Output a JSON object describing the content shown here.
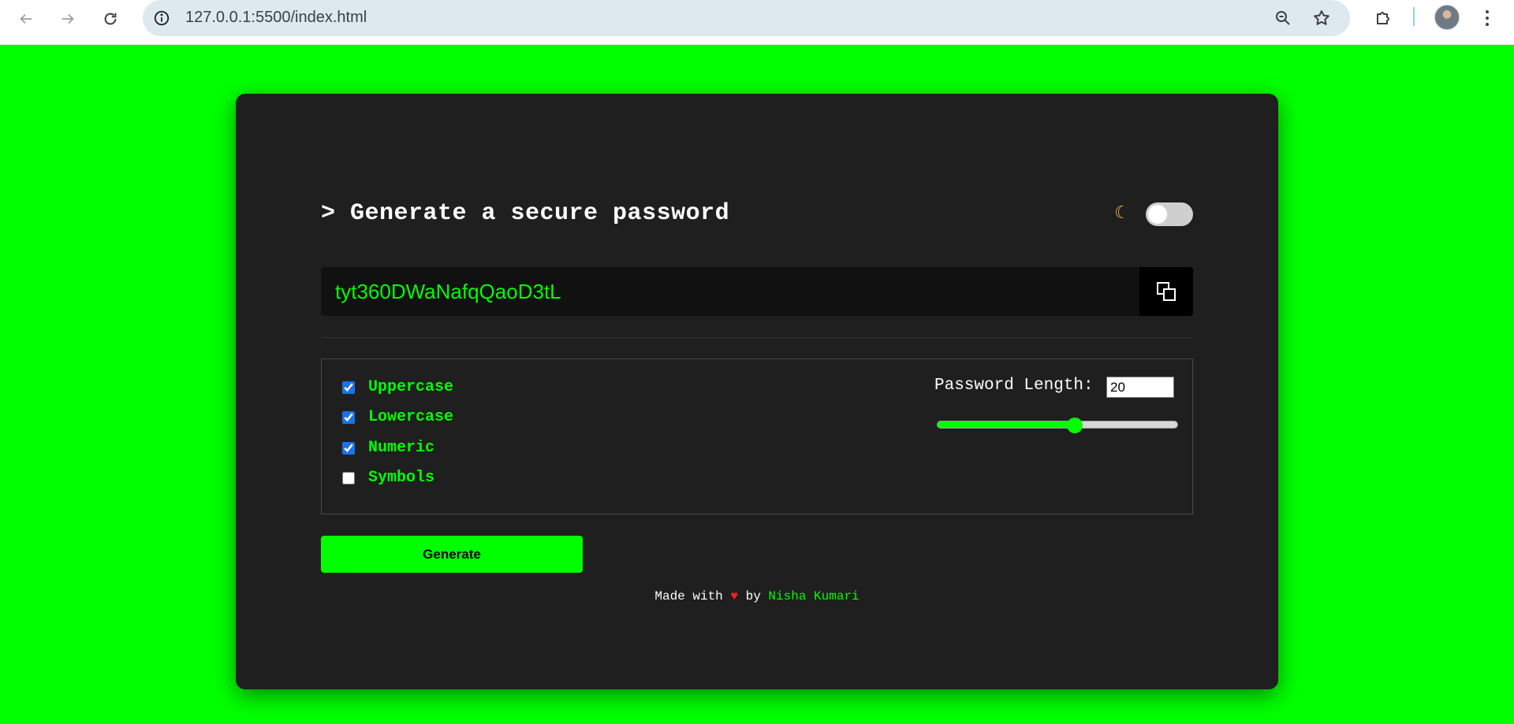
{
  "browser": {
    "url": "127.0.0.1:5500/index.html",
    "icons": [
      "back-arrow-icon",
      "forward-arrow-icon",
      "reload-icon",
      "site-info-icon",
      "zoom-icon",
      "bookmark-star-icon",
      "extensions-icon",
      "profile-avatar",
      "more-menu-icon"
    ]
  },
  "app": {
    "heading": "> Generate a secure password",
    "theme_icon": "moon-icon",
    "theme_toggle_on": false,
    "password": "tyt360DWaNafqQaoD3tL",
    "copy_icon": "copy-icon",
    "options": [
      {
        "label": "Uppercase",
        "checked": true
      },
      {
        "label": "Lowercase",
        "checked": true
      },
      {
        "label": "Numeric",
        "checked": true
      },
      {
        "label": "Symbols",
        "checked": false
      }
    ],
    "length_label": "Password Length:",
    "length_value": "20",
    "slider": {
      "min": 0,
      "max": 35,
      "value": 20
    },
    "generate_label": "Generate",
    "footer": {
      "prefix": "Made with",
      "heart": "♥",
      "by": "by",
      "author": "Nisha Kumari"
    }
  },
  "colors": {
    "accent": "#00ff00",
    "card": "#1f1f1f",
    "background": "#00ff00",
    "heart": "#ff1f1f"
  }
}
